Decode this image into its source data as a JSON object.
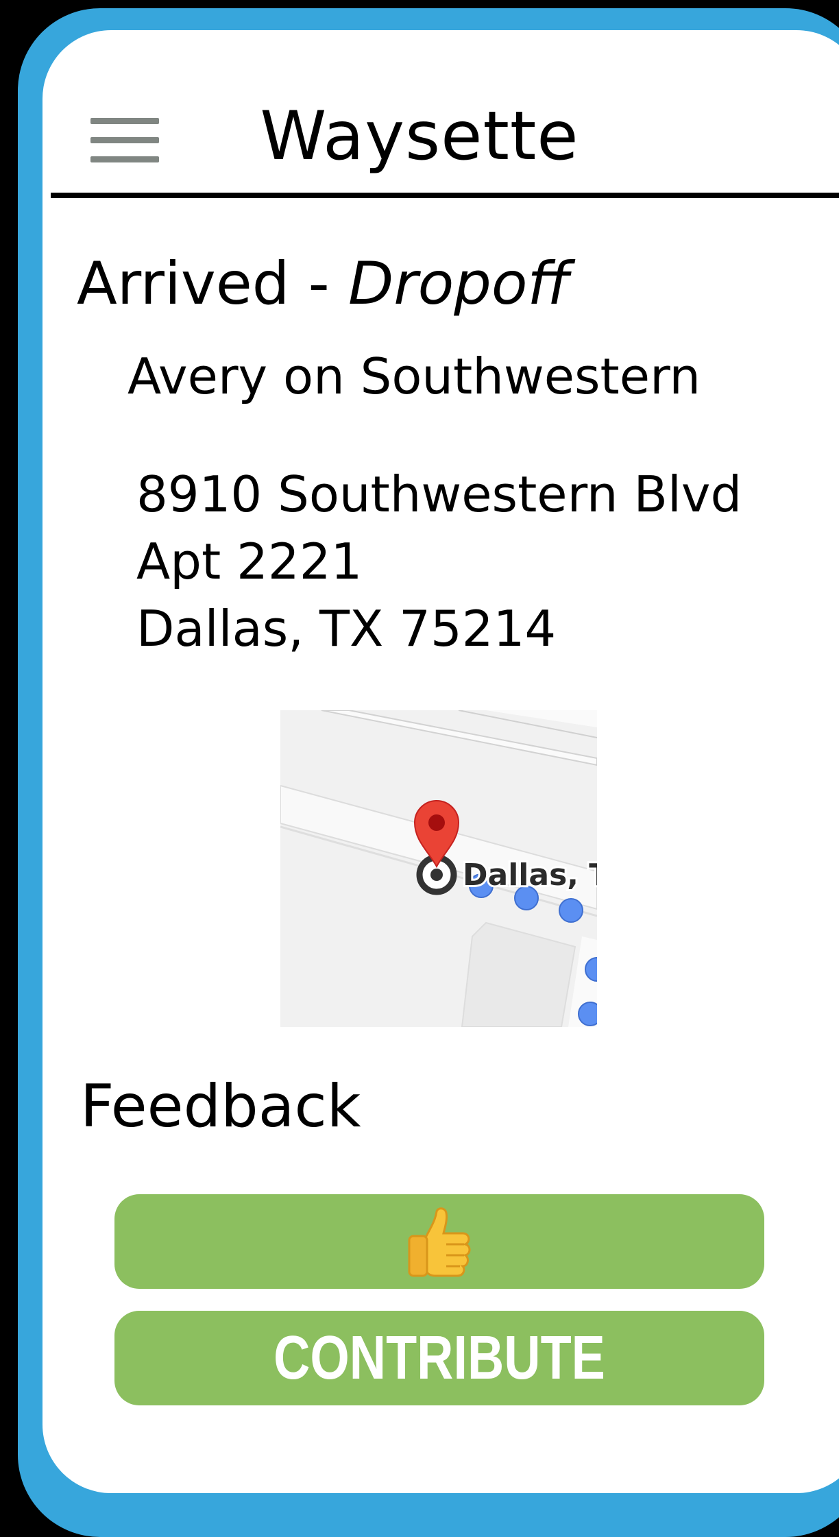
{
  "app": {
    "title": "Waysette",
    "menu_icon": "hamburger-menu-icon"
  },
  "status": {
    "state": "Arrived - ",
    "type": "Dropoff"
  },
  "destination": {
    "name": "Avery on Southwestern",
    "address_line1": "8910 Southwestern Blvd",
    "address_line2": "Apt 2221",
    "address_line3": "Dallas, TX 75214"
  },
  "map": {
    "label": "Dallas, T",
    "pin_color": "#ea4335",
    "route_dot_color": "#5b8ff2"
  },
  "feedback": {
    "heading": "Feedback",
    "thumbs_up_icon": "thumbs-up-icon",
    "contribute_label": "CONTRIBUTE"
  },
  "colors": {
    "frame": "#37a6dc",
    "button": "#8cbf5f"
  }
}
